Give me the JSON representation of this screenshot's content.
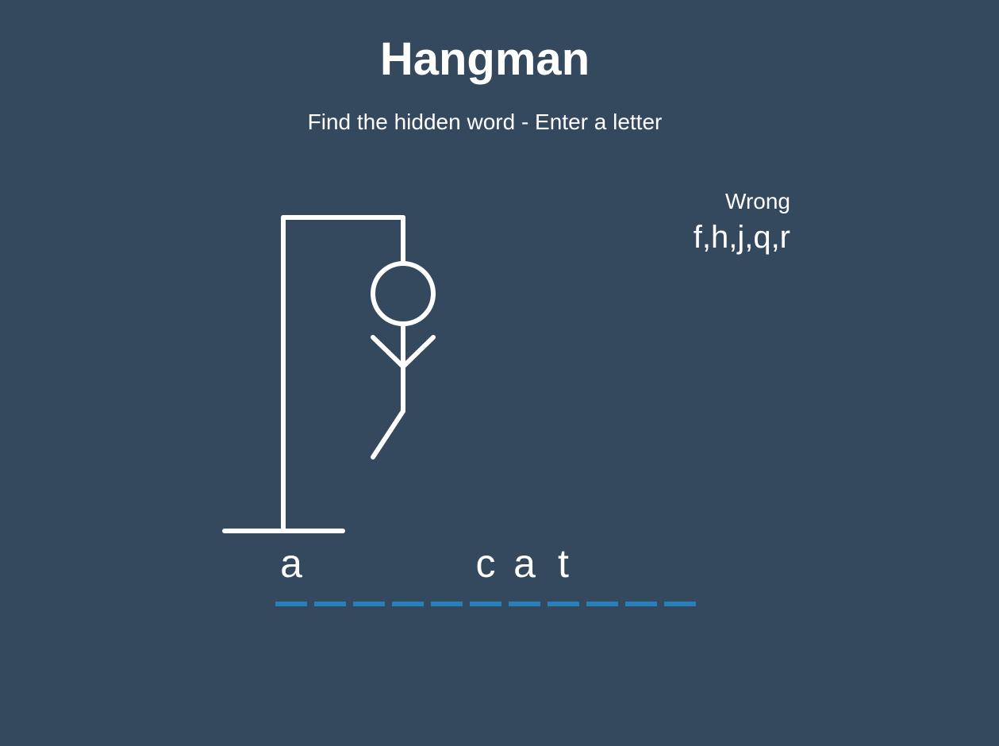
{
  "game": {
    "title": "Hangman",
    "subtitle": "Find the hidden word - Enter a letter"
  },
  "wrong_letters": {
    "label": "Wrong",
    "letters": "f,h,j,q,r",
    "count": 5
  },
  "word": {
    "letters": [
      "a",
      "",
      "",
      "",
      "",
      "c",
      "a",
      "t",
      "",
      "",
      ""
    ]
  },
  "colors": {
    "background": "#34495e",
    "foreground": "#ffffff",
    "underline": "#2980b9"
  }
}
